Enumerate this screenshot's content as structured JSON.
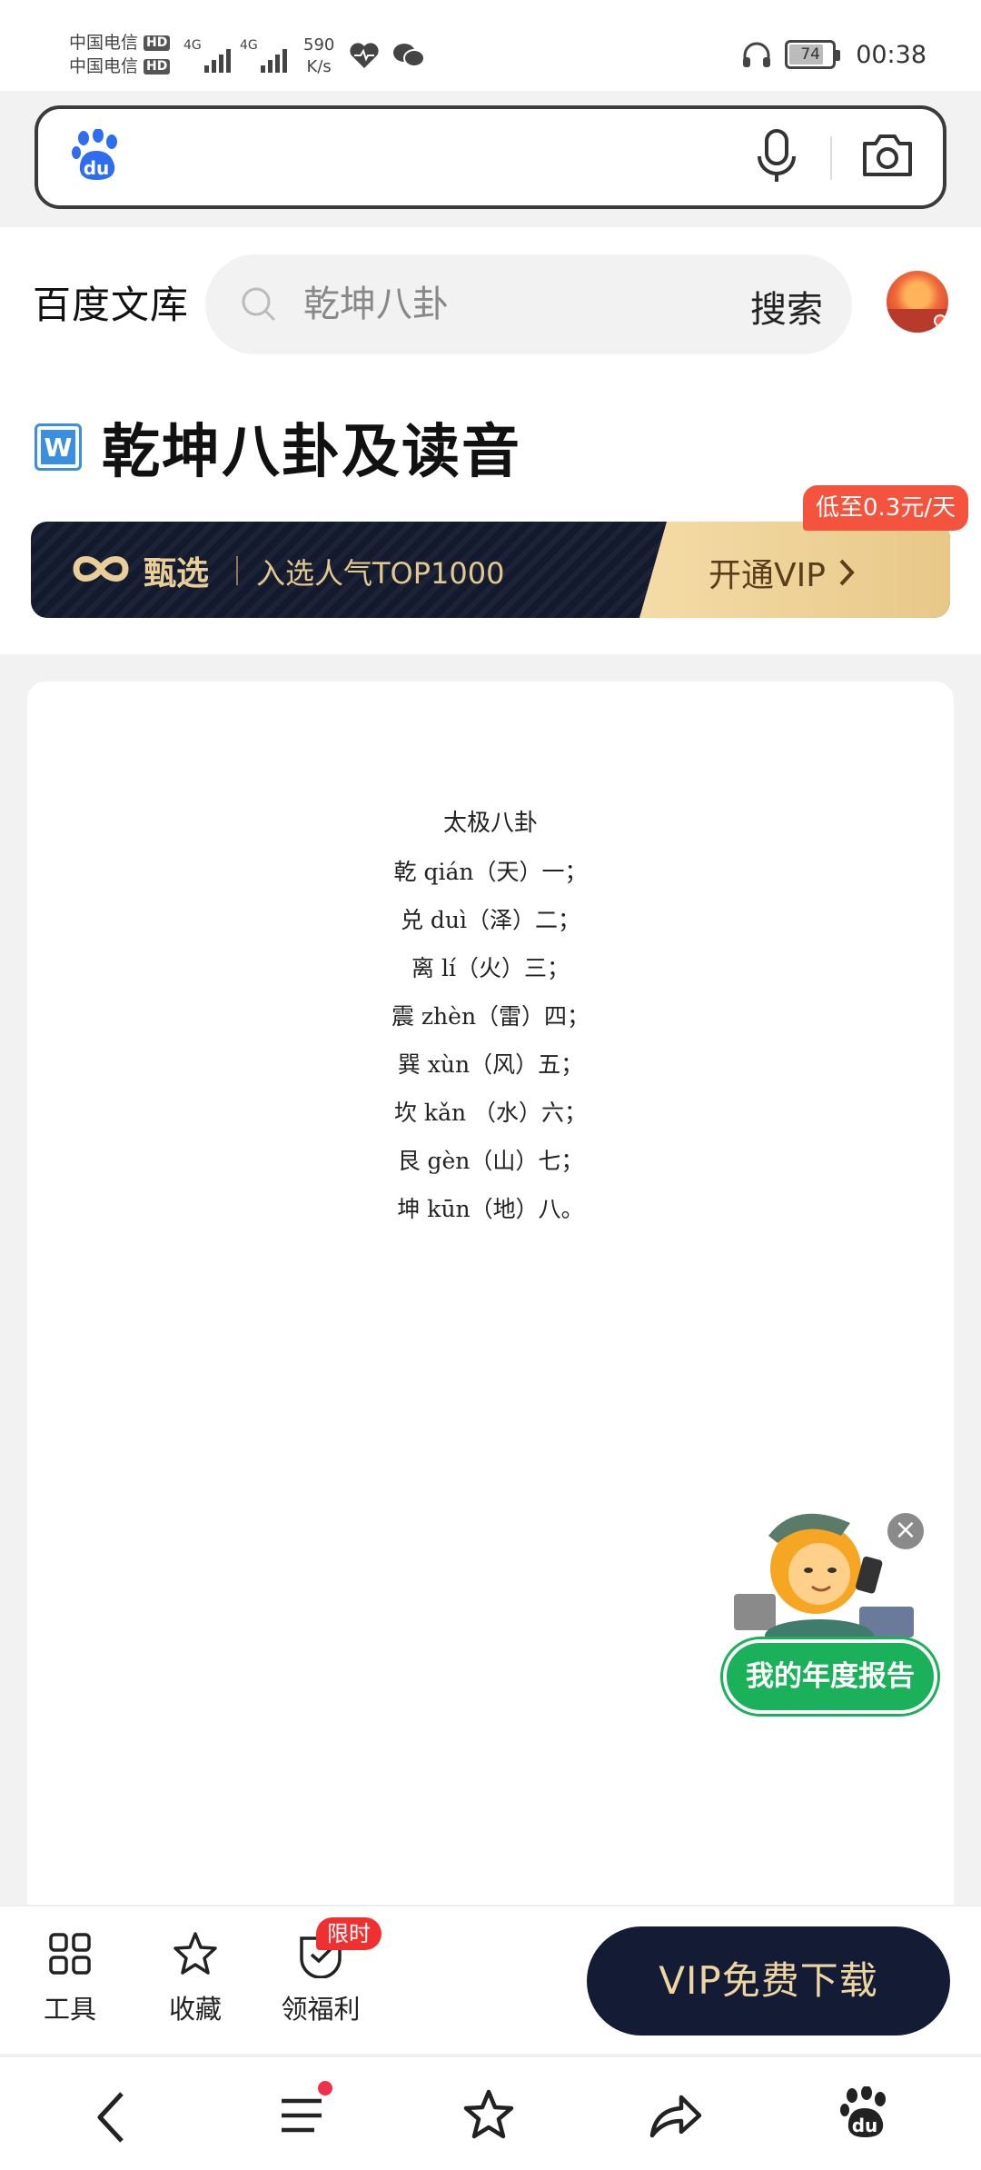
{
  "status_bar": {
    "carrier_1": "中国电信",
    "carrier_2": "中国电信",
    "hd_badge": "HD",
    "network_1": "4G",
    "network_2": "4G",
    "speed_value": "590",
    "speed_unit": "K/s",
    "battery": "74",
    "time": "00:38"
  },
  "baidu_bar": {
    "logo_text": "du",
    "icons": [
      "baidu-paw-icon",
      "microphone-icon",
      "camera-icon"
    ]
  },
  "wenku_header": {
    "brand": "百度文库",
    "search_placeholder": "乾坤八卦",
    "search_button": "搜索"
  },
  "document": {
    "badge": "W",
    "title": "乾坤八卦及读音",
    "lines": [
      "太极八卦",
      "乾 qián（天）一；",
      "兑 duì（泽）二；",
      "离 lí（火）三；",
      "震 zhèn（雷）四；",
      "巽 xùn（风）五；",
      "坎 kǎn （水）六；",
      "艮 gèn（山）七；",
      "坤 kūn（地）八。"
    ]
  },
  "vip_banner": {
    "label": "甄选",
    "subtitle": "入选人气TOP1000",
    "cta": "开通VIP",
    "price_tag": "低至0.3元/天",
    "colors": {
      "dark": "#131a2e",
      "gold": "#e9cf97",
      "tag": "#f4533e"
    }
  },
  "promo": {
    "button": "我的年度报告",
    "close": "×"
  },
  "action_bar": {
    "tools": "工具",
    "favorite": "收藏",
    "benefits": "领福利",
    "limited_badge": "限时",
    "vip_download": "VIP免费下载"
  },
  "nav_bar": {
    "icons": [
      "back-icon",
      "menu-icon",
      "star-icon",
      "share-icon",
      "baidu-paw-icon"
    ]
  }
}
